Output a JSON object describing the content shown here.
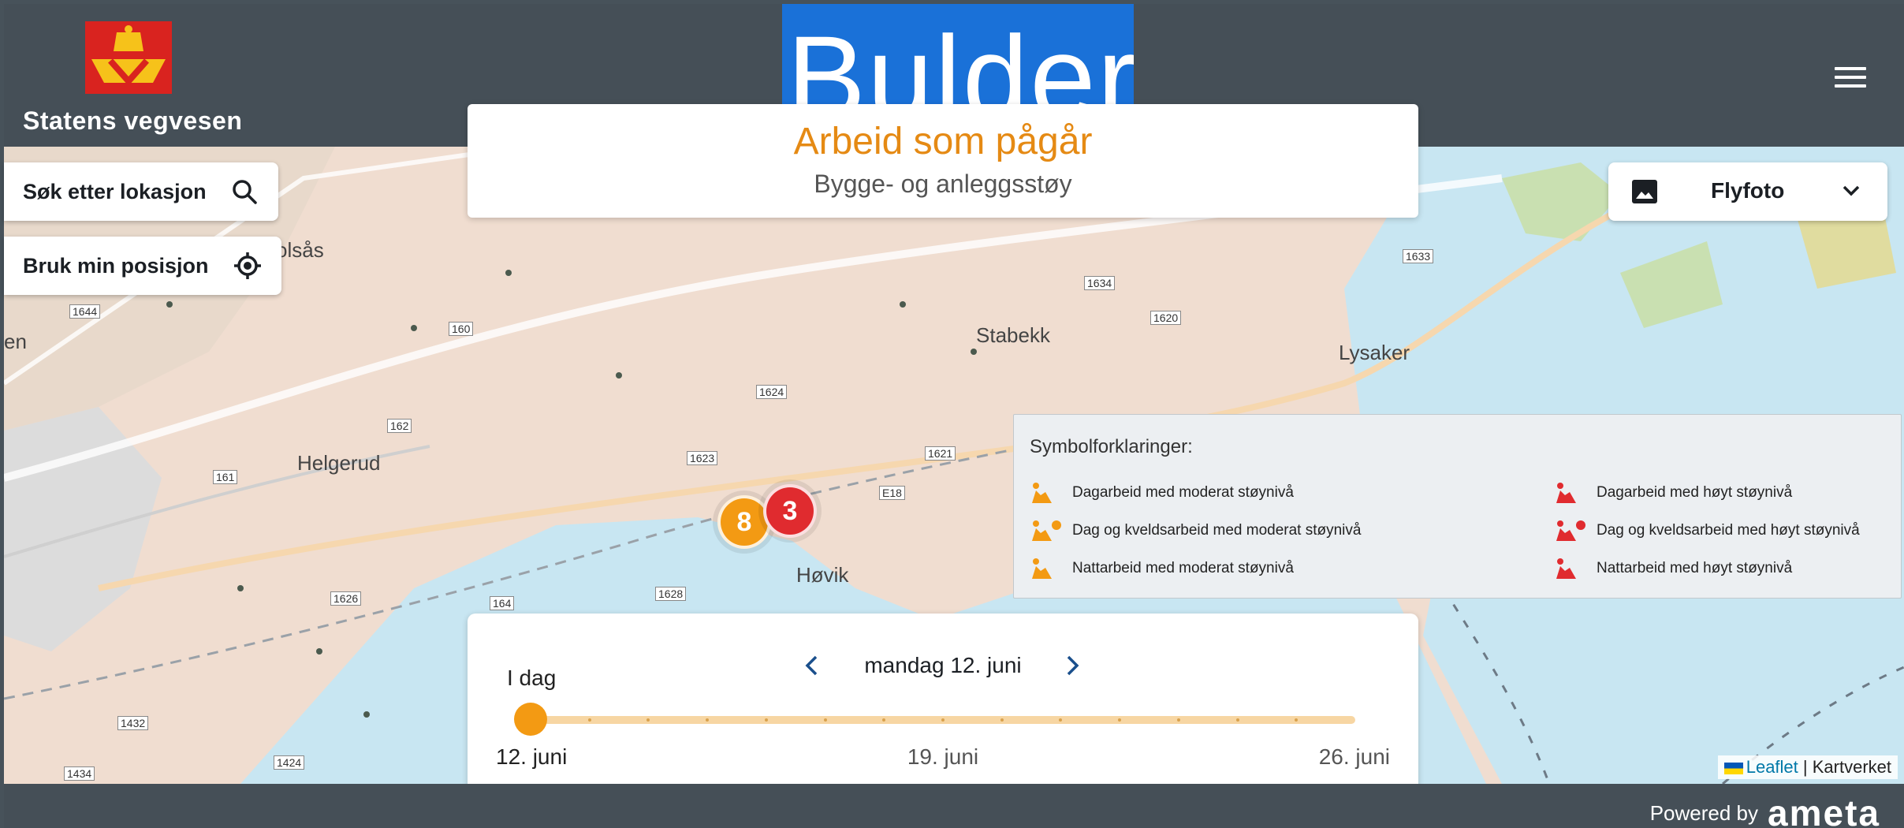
{
  "header": {
    "brand_name": "Statens vegvesen",
    "app_banner_text": "Bulder",
    "menu_icon": "hamburger-menu-icon"
  },
  "title_card": {
    "title": "Arbeid som pågår",
    "subtitle": "Bygge- og anleggsstøy"
  },
  "controls": {
    "search_label": "Søk etter lokasjon",
    "search_icon": "search-icon",
    "position_label": "Bruk min posisjon",
    "position_icon": "crosshair-icon"
  },
  "basemap_select": {
    "icon": "image-icon",
    "selected": "Flyfoto",
    "chevron": "chevron-down-icon"
  },
  "map": {
    "place_labels": [
      "olsås",
      "en",
      "Helgerud",
      "Stabekk",
      "Lysaker",
      "Høvik"
    ],
    "road_labels": [
      "1644",
      "160",
      "162",
      "161",
      "1626",
      "164",
      "1432",
      "1434",
      "1424",
      "E18",
      "1623",
      "1624",
      "1621",
      "1628",
      "1634",
      "1620",
      "1633"
    ],
    "clusters": [
      {
        "count": "8",
        "color": "#f39a13"
      },
      {
        "count": "3",
        "color": "#e02b2f"
      }
    ]
  },
  "legend": {
    "title": "Symbolforklaringer:",
    "items": [
      {
        "label": "Dagarbeid med moderat støynivå",
        "color": "#f39a13",
        "icon": "digger-day-icon"
      },
      {
        "label": "Dag og kveldsarbeid med moderat støynivå",
        "color": "#f39a13",
        "icon": "digger-evening-icon"
      },
      {
        "label": "Nattarbeid med moderat støynivå",
        "color": "#f39a13",
        "icon": "digger-night-icon"
      },
      {
        "label": "Dagarbeid med høyt støynivå",
        "color": "#e02b2f",
        "icon": "digger-day-icon"
      },
      {
        "label": "Dag og kveldsarbeid med høyt støynivå",
        "color": "#e02b2f",
        "icon": "digger-evening-icon"
      },
      {
        "label": "Nattarbeid med høyt støynivå",
        "color": "#e02b2f",
        "icon": "digger-night-icon"
      }
    ]
  },
  "timeline": {
    "today_label": "I dag",
    "current_date": "mandag 12. juni",
    "start_label": "12. juni",
    "mid_label": "19. juni",
    "end_label": "26. juni",
    "selected_day_index": 0,
    "day_count": 15
  },
  "attribution": {
    "leaflet": "Leaflet",
    "separator": " | ",
    "provider": "Kartverket"
  },
  "footer": {
    "powered_by": "Powered by",
    "brand": "ameta"
  },
  "colors": {
    "header_bg": "#454f57",
    "accent_orange": "#f39a13",
    "accent_red": "#e02b2f",
    "banner_blue": "#1a71d8"
  }
}
